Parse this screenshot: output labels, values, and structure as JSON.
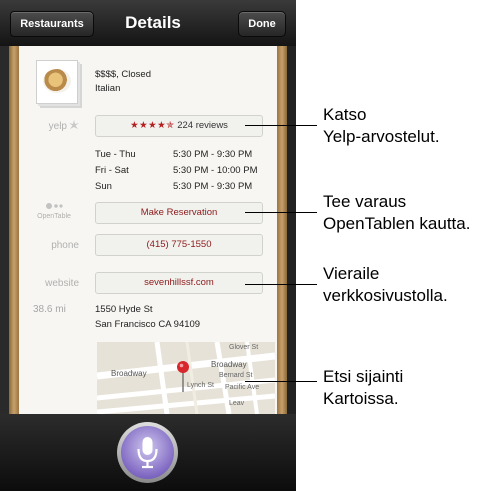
{
  "nav": {
    "back_label": "Restaurants",
    "title": "Details",
    "done_label": "Done"
  },
  "restaurant": {
    "price_status": "$$$$, Closed",
    "cuisine": "Italian"
  },
  "yelp": {
    "label": "yelp",
    "stars": "★★★★✯",
    "reviews": "224 reviews"
  },
  "hours": [
    {
      "days": "Tue - Thu",
      "time": "5:30 PM - 9:30 PM"
    },
    {
      "days": "Fri - Sat",
      "time": "5:30 PM - 10:00 PM"
    },
    {
      "days": "Sun",
      "time": "5:30 PM - 9:30 PM"
    }
  ],
  "opentable": {
    "label": "OpenTable",
    "button": "Make Reservation"
  },
  "phone": {
    "label": "phone",
    "value": "(415) 775-1550"
  },
  "website": {
    "label": "website",
    "value": "sevenhillssf.com"
  },
  "address": {
    "distance": "38.6 mi",
    "line1": "1550 Hyde St",
    "line2": "San Francisco CA 94109"
  },
  "map": {
    "streets": [
      "Glover St",
      "Broadway",
      "Broadway",
      "Bernard St",
      "Pacific Ave",
      "Lynch St",
      "Leav"
    ]
  },
  "callouts": [
    {
      "line1": "Katso",
      "line2": "Yelp-arvostelut."
    },
    {
      "line1": "Tee varaus",
      "line2": "OpenTablen kautta."
    },
    {
      "line1": "Vieraile",
      "line2": "verkkosivustolla."
    },
    {
      "line1": "Etsi sijainti",
      "line2": "Kartoissa."
    }
  ],
  "colors": {
    "accent": "#8c1a1a",
    "frame": "#c7a06a",
    "siri": "#7f68c2"
  }
}
